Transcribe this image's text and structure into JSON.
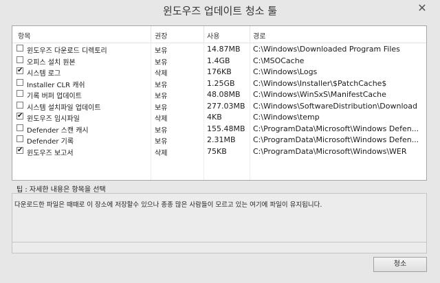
{
  "window": {
    "title": "윈도우즈 업데이트 청소 툴",
    "close_glyph": "✕"
  },
  "list": {
    "columns": [
      "항목",
      "권장",
      "사용",
      "경로"
    ],
    "rows": [
      {
        "checked": false,
        "name": "윈도우즈 다운로드 디렉토리",
        "perm": "보유",
        "size": "14.87MB",
        "path": "C:\\Windows\\Downloaded Program Files"
      },
      {
        "checked": false,
        "name": "오피스 설치 원본",
        "perm": "보유",
        "size": "1.4GB",
        "path": "C:\\MSOCache"
      },
      {
        "checked": true,
        "name": "시스템 로그",
        "perm": "삭제",
        "size": "176KB",
        "path": "C:\\Windows\\Logs"
      },
      {
        "checked": false,
        "name": "Installer CLR 캐쉬",
        "perm": "보유",
        "size": "1.25GB",
        "path": "C:\\Windows\\Installer\\$PatchCache$"
      },
      {
        "checked": false,
        "name": "기록 버퍼 업데이트",
        "perm": "보유",
        "size": "48.08MB",
        "path": "C:\\Windows\\WinSxS\\ManifestCache"
      },
      {
        "checked": false,
        "name": "시스템 설치파일 업데이트",
        "perm": "보유",
        "size": "277.03MB",
        "path": "C:\\Windows\\SoftwareDistribution\\Download"
      },
      {
        "checked": true,
        "name": "윈도우즈 임시파일",
        "perm": "삭제",
        "size": "4KB",
        "path": "C:\\Windows\\temp"
      },
      {
        "checked": false,
        "name": "Defender 스캔 캐시",
        "perm": "보유",
        "size": "155.48MB",
        "path": "C:\\ProgramData\\Microsoft\\Windows Defen..."
      },
      {
        "checked": false,
        "name": "Defender 기록",
        "perm": "보유",
        "size": "2.31MB",
        "path": "C:\\ProgramData\\Microsoft\\Windows Defen..."
      },
      {
        "checked": true,
        "name": "윈도우즈 보고서",
        "perm": "삭제",
        "size": "75KB",
        "path": "C:\\ProgramData\\Microsoft\\Windows\\WER"
      }
    ]
  },
  "tip": {
    "label": "팁 : 자세한 내용은 항목을 선택",
    "text": "다운로드한 파일은 때때로  이 장소에 저장할수 있으나 종종 많은 사람들이 모르고 있는 여기에 파일이 유지됩니다."
  },
  "buttons": {
    "clean_label": "청소"
  }
}
